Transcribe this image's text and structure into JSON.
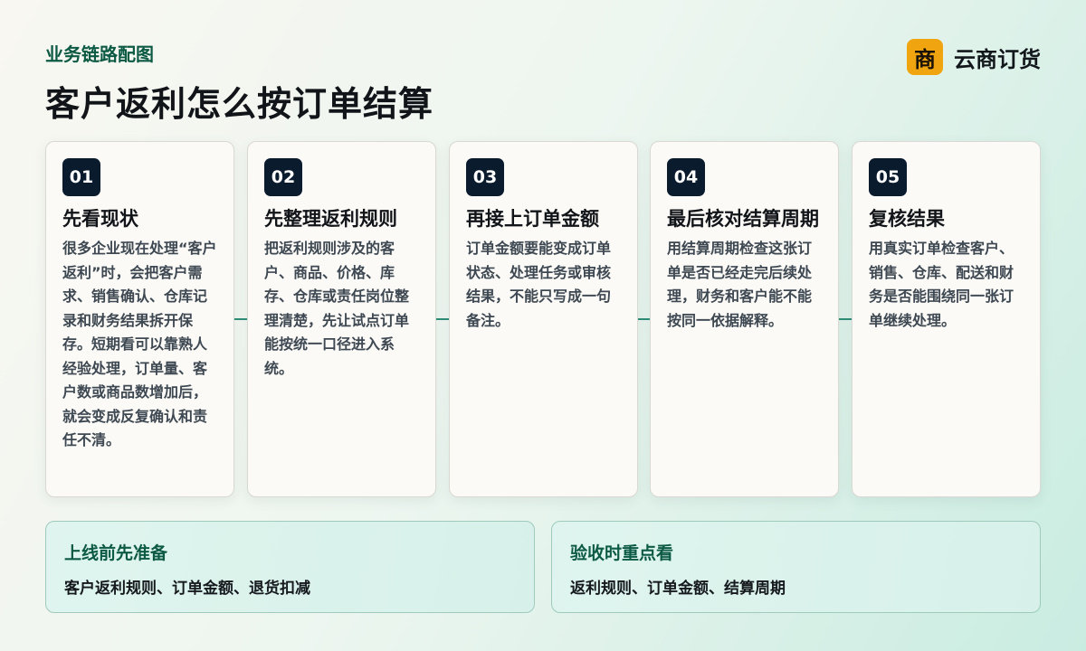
{
  "header": {
    "eyebrow": "业务链路配图",
    "title": "客户返利怎么按订单结算"
  },
  "brand": {
    "logo_char": "商",
    "name": "云商订货",
    "logo_color": "#f0a410"
  },
  "steps": [
    {
      "number": "01",
      "title": "先看现状",
      "body": "很多企业现在处理“客户返利”时，会把客户需求、销售确认、仓库记录和财务结果拆开保存。短期看可以靠熟人经验处理，订单量、客户数或商品数增加后，就会变成反复确认和责任不清。"
    },
    {
      "number": "02",
      "title": "先整理返利规则",
      "body": "把返利规则涉及的客户、商品、价格、库存、仓库或责任岗位整理清楚，先让试点订单能按统一口径进入系统。"
    },
    {
      "number": "03",
      "title": "再接上订单金额",
      "body": "订单金额要能变成订单状态、处理任务或审核结果，不能只写成一句备注。"
    },
    {
      "number": "04",
      "title": "最后核对结算周期",
      "body": "用结算周期检查这张订单是否已经走完后续处理，财务和客户能不能按同一依据解释。"
    },
    {
      "number": "05",
      "title": "复核结果",
      "body": "用真实订单检查客户、销售、仓库、配送和财务是否能围绕同一张订单继续处理。"
    }
  ],
  "panels": [
    {
      "title": "上线前先准备",
      "body": "客户返利规则、订单金额、退货扣减"
    },
    {
      "title": "验收时重点看",
      "body": "返利规则、订单金额、结算周期"
    }
  ],
  "colors": {
    "accent": "#0c5a44",
    "badge": "#0b1b2e",
    "connector": "#2f8f78"
  }
}
